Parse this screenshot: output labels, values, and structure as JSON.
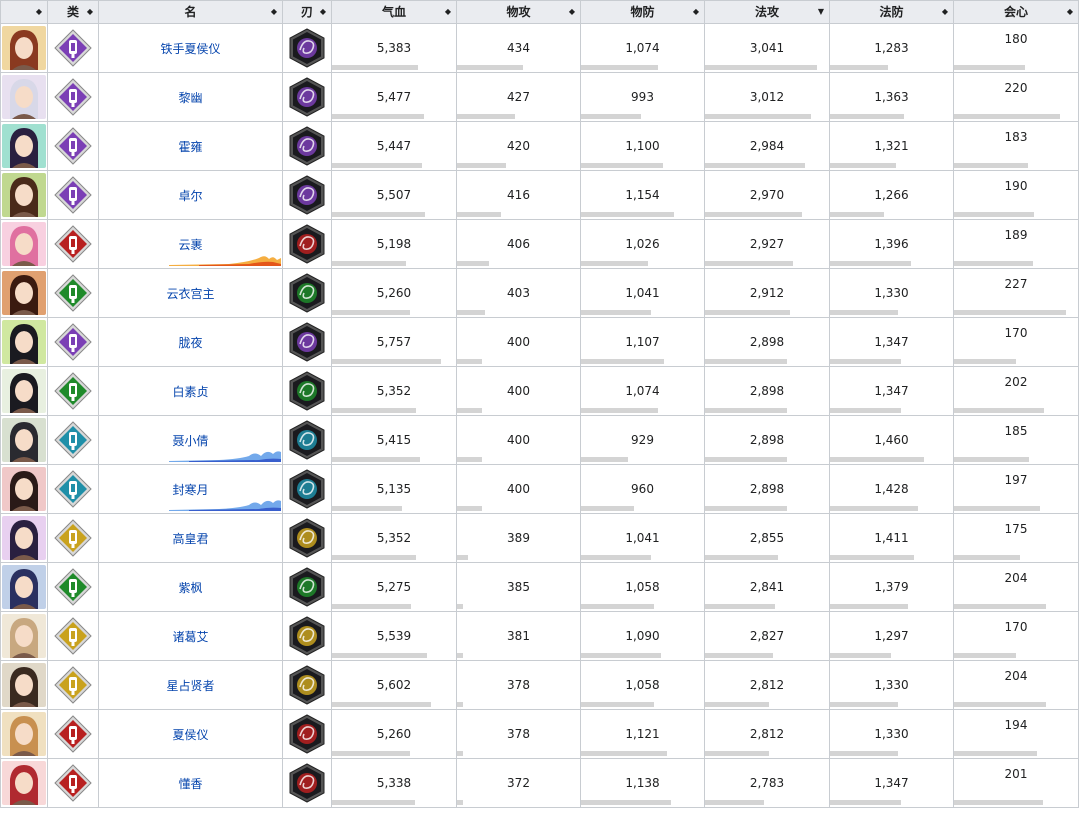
{
  "headers": [
    {
      "label": ""
    },
    {
      "label": "类"
    },
    {
      "label": "名"
    },
    {
      "label": "刃"
    },
    {
      "label": "气血"
    },
    {
      "label": "物攻"
    },
    {
      "label": "物防"
    },
    {
      "label": "法攻"
    },
    {
      "label": "法防"
    },
    {
      "label": "会心"
    }
  ],
  "sort_indicator": "◆",
  "sort_active": "▼",
  "colors": {
    "purple": "#7b3fb5",
    "red": "#b82020",
    "green": "#1f8a2a",
    "teal": "#1f8fa8",
    "gold": "#c9a21e"
  },
  "rows": [
    {
      "name": "铁手夏侯仪",
      "class_color": "purple",
      "blade_color": "purple",
      "avatar_hair": "#8a3a20",
      "avatar_bg": "#f0d7a0",
      "hp": "5,383",
      "patk": "434",
      "pdef": "1,074",
      "matk": "3,041",
      "mdef": "1,283",
      "crit": "180",
      "fx": ""
    },
    {
      "name": "黎幽",
      "class_color": "purple",
      "blade_color": "purple",
      "avatar_hair": "#d8d8e8",
      "avatar_bg": "#e8e0f0",
      "hp": "5,477",
      "patk": "427",
      "pdef": "993",
      "matk": "3,012",
      "mdef": "1,363",
      "crit": "220",
      "fx": ""
    },
    {
      "name": "霍雍",
      "class_color": "purple",
      "blade_color": "purple",
      "avatar_hair": "#2a2040",
      "avatar_bg": "#a0e0d0",
      "hp": "5,447",
      "patk": "420",
      "pdef": "1,100",
      "matk": "2,984",
      "mdef": "1,321",
      "crit": "183",
      "fx": ""
    },
    {
      "name": "卓尔",
      "class_color": "purple",
      "blade_color": "purple",
      "avatar_hair": "#4a2a1a",
      "avatar_bg": "#c0d890",
      "hp": "5,507",
      "patk": "416",
      "pdef": "1,154",
      "matk": "2,970",
      "mdef": "1,266",
      "crit": "190",
      "fx": ""
    },
    {
      "name": "云裹",
      "class_color": "red",
      "blade_color": "red",
      "avatar_hair": "#e070a0",
      "avatar_bg": "#f8d0e0",
      "hp": "5,198",
      "patk": "406",
      "pdef": "1,026",
      "matk": "2,927",
      "mdef": "1,396",
      "crit": "189",
      "fx": "fire"
    },
    {
      "name": "云衣宫主",
      "class_color": "green",
      "blade_color": "green",
      "avatar_hair": "#3a1a10",
      "avatar_bg": "#e0a070",
      "hp": "5,260",
      "patk": "403",
      "pdef": "1,041",
      "matk": "2,912",
      "mdef": "1,330",
      "crit": "227",
      "fx": ""
    },
    {
      "name": "胧夜",
      "class_color": "purple",
      "blade_color": "purple",
      "avatar_hair": "#1a1a20",
      "avatar_bg": "#d0e8a0",
      "hp": "5,757",
      "patk": "400",
      "pdef": "1,107",
      "matk": "2,898",
      "mdef": "1,347",
      "crit": "170",
      "fx": ""
    },
    {
      "name": "白素贞",
      "class_color": "green",
      "blade_color": "green",
      "avatar_hair": "#1a1a20",
      "avatar_bg": "#e8f0e0",
      "hp": "5,352",
      "patk": "400",
      "pdef": "1,074",
      "matk": "2,898",
      "mdef": "1,347",
      "crit": "202",
      "fx": ""
    },
    {
      "name": "聂小倩",
      "class_color": "teal",
      "blade_color": "teal",
      "avatar_hair": "#2a2a30",
      "avatar_bg": "#d8e0d0",
      "hp": "5,415",
      "patk": "400",
      "pdef": "929",
      "matk": "2,898",
      "mdef": "1,460",
      "crit": "185",
      "fx": "water"
    },
    {
      "name": "封寒月",
      "class_color": "teal",
      "blade_color": "teal",
      "avatar_hair": "#2a1a18",
      "avatar_bg": "#f0c8c8",
      "hp": "5,135",
      "patk": "400",
      "pdef": "960",
      "matk": "2,898",
      "mdef": "1,428",
      "crit": "197",
      "fx": "water"
    },
    {
      "name": "高皇君",
      "class_color": "gold",
      "blade_color": "gold",
      "avatar_hair": "#2a2040",
      "avatar_bg": "#e8d0f0",
      "hp": "5,352",
      "patk": "389",
      "pdef": "1,041",
      "matk": "2,855",
      "mdef": "1,411",
      "crit": "175",
      "fx": ""
    },
    {
      "name": "紫枫",
      "class_color": "green",
      "blade_color": "green",
      "avatar_hair": "#2a3060",
      "avatar_bg": "#c0d0e8",
      "hp": "5,275",
      "patk": "385",
      "pdef": "1,058",
      "matk": "2,841",
      "mdef": "1,379",
      "crit": "204",
      "fx": ""
    },
    {
      "name": "诸葛艾",
      "class_color": "gold",
      "blade_color": "gold",
      "avatar_hair": "#c8a880",
      "avatar_bg": "#f0e8d8",
      "hp": "5,539",
      "patk": "381",
      "pdef": "1,090",
      "matk": "2,827",
      "mdef": "1,297",
      "crit": "170",
      "fx": ""
    },
    {
      "name": "星占贤者",
      "class_color": "gold",
      "blade_color": "gold",
      "avatar_hair": "#3a2a20",
      "avatar_bg": "#e0d8c8",
      "hp": "5,602",
      "patk": "378",
      "pdef": "1,058",
      "matk": "2,812",
      "mdef": "1,330",
      "crit": "204",
      "fx": ""
    },
    {
      "name": "夏侯仪",
      "class_color": "red",
      "blade_color": "red",
      "avatar_hair": "#c89050",
      "avatar_bg": "#f0e0c0",
      "hp": "5,260",
      "patk": "378",
      "pdef": "1,121",
      "matk": "2,812",
      "mdef": "1,330",
      "crit": "194",
      "fx": ""
    },
    {
      "name": "懂香",
      "class_color": "red",
      "blade_color": "red",
      "avatar_hair": "#b02a30",
      "avatar_bg": "#f8d8d8",
      "hp": "5,338",
      "patk": "372",
      "pdef": "1,138",
      "matk": "2,783",
      "mdef": "1,347",
      "crit": "201",
      "fx": ""
    }
  ]
}
